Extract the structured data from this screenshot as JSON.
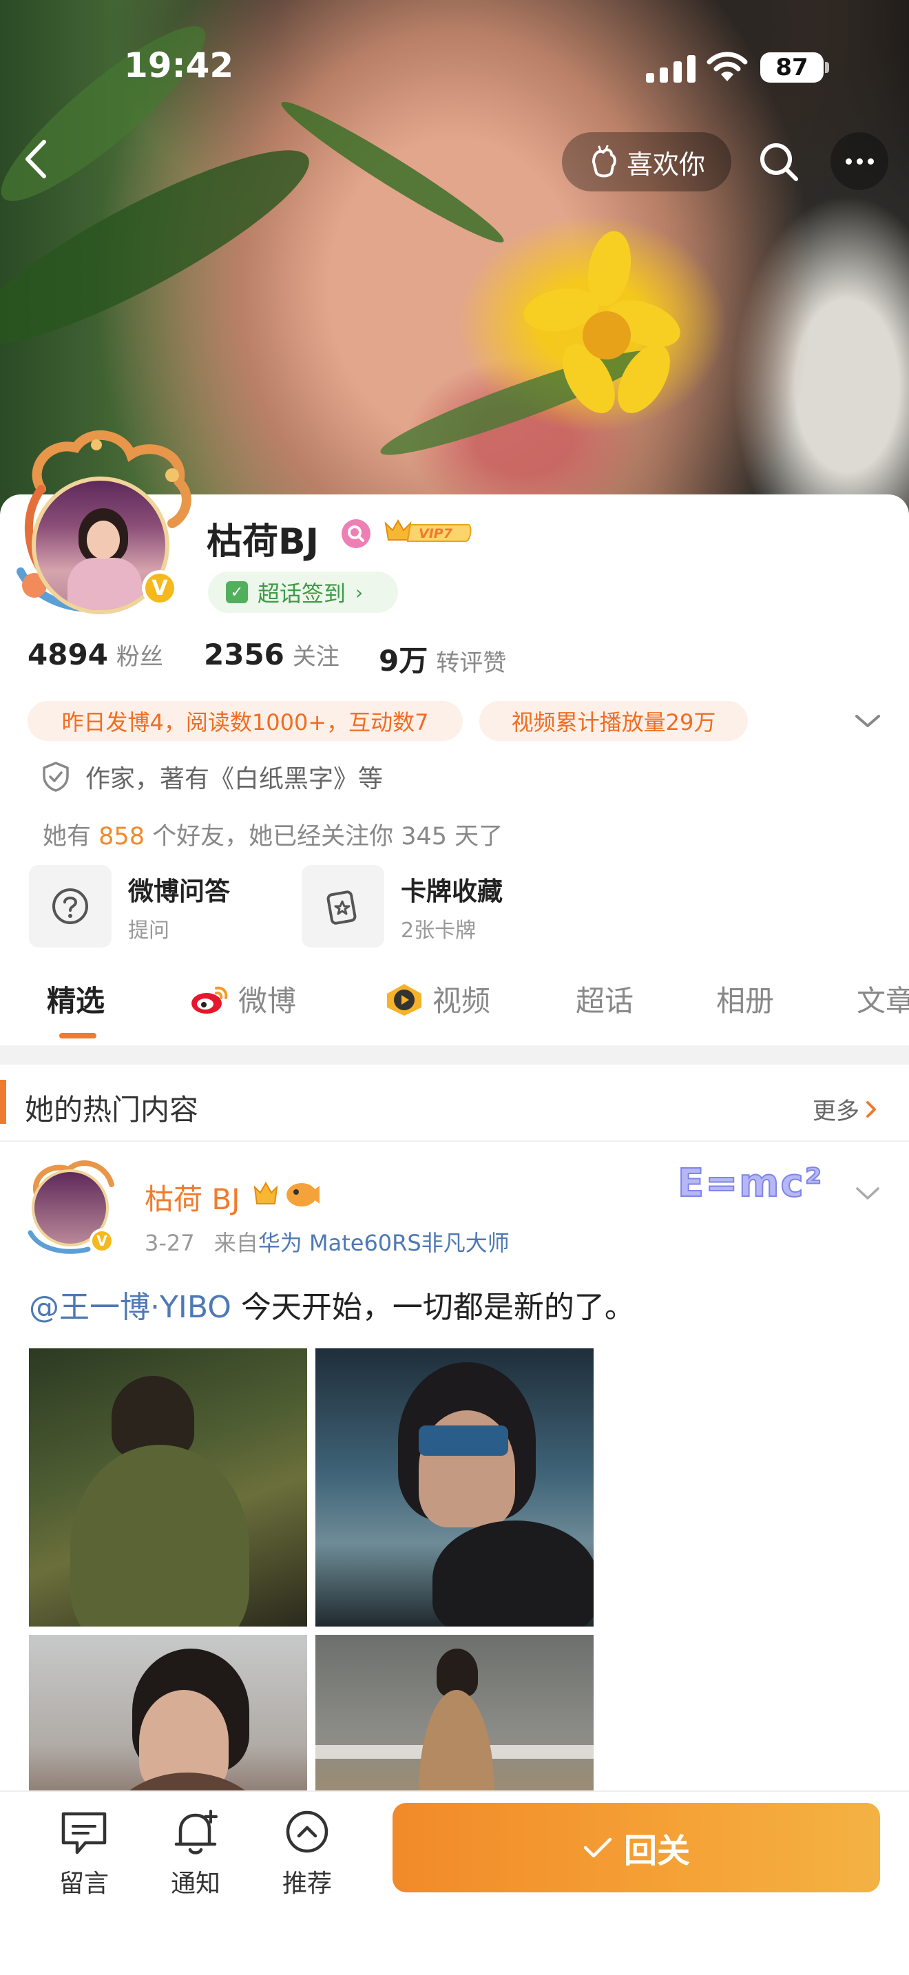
{
  "status_bar": {
    "time": "19:42",
    "battery": "87"
  },
  "nav": {
    "like_label": "喜欢你"
  },
  "profile": {
    "name": "枯荷BJ",
    "verified_mark": "V",
    "vip_label": "VIP7",
    "checkin_label": "超话签到",
    "stats": [
      {
        "value": "4894",
        "label": "粉丝"
      },
      {
        "value": "2356",
        "label": "关注"
      },
      {
        "value": "9万",
        "label": "转评赞"
      }
    ],
    "tags": [
      "昨日发博4，阅读数1000+，互动数7",
      "视频累计播放量29万"
    ],
    "bio": "作家，著有《白纸黑字》等",
    "friends": {
      "prefix": "她有",
      "count": "858",
      "suffix": "个好友，她已经关注你 345 天了"
    },
    "entries": [
      {
        "title": "微博问答",
        "subtitle": "提问"
      },
      {
        "title": "卡牌收藏",
        "subtitle": "2张卡牌"
      }
    ]
  },
  "tabs": [
    {
      "label": "精选",
      "active": true
    },
    {
      "label": "微博"
    },
    {
      "label": "视频"
    },
    {
      "label": "超话"
    },
    {
      "label": "相册"
    },
    {
      "label": "文章"
    }
  ],
  "hot_section": {
    "title": "她的热门内容",
    "more_label": "更多"
  },
  "post": {
    "author": "枯荷 BJ",
    "date": "3-27",
    "source_prefix": "来自",
    "device": "华为 Mate60RS非凡大师",
    "sticker_text": "E=mc²",
    "mention": "@王一博·YIBO",
    "text": " 今天开始，一切都是新的了。"
  },
  "bottom_bar": {
    "items": [
      {
        "label": "留言",
        "icon": "message-icon"
      },
      {
        "label": "通知",
        "icon": "bell-plus-icon"
      },
      {
        "label": "推荐",
        "icon": "chevron-up-circle-icon"
      }
    ],
    "follow_back_label": "回关"
  },
  "colors": {
    "accent": "#f07b2e",
    "link": "#4e79b4",
    "green": "#3f9a47"
  }
}
